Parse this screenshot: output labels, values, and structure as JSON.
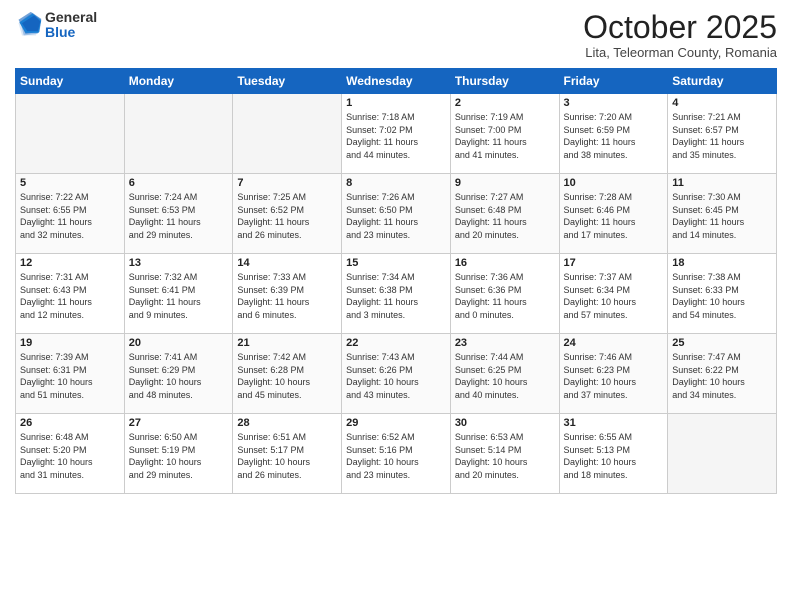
{
  "logo": {
    "general": "General",
    "blue": "Blue"
  },
  "header": {
    "month": "October 2025",
    "location": "Lita, Teleorman County, Romania"
  },
  "weekdays": [
    "Sunday",
    "Monday",
    "Tuesday",
    "Wednesday",
    "Thursday",
    "Friday",
    "Saturday"
  ],
  "weeks": [
    [
      {
        "day": "",
        "info": ""
      },
      {
        "day": "",
        "info": ""
      },
      {
        "day": "",
        "info": ""
      },
      {
        "day": "1",
        "info": "Sunrise: 7:18 AM\nSunset: 7:02 PM\nDaylight: 11 hours\nand 44 minutes."
      },
      {
        "day": "2",
        "info": "Sunrise: 7:19 AM\nSunset: 7:00 PM\nDaylight: 11 hours\nand 41 minutes."
      },
      {
        "day": "3",
        "info": "Sunrise: 7:20 AM\nSunset: 6:59 PM\nDaylight: 11 hours\nand 38 minutes."
      },
      {
        "day": "4",
        "info": "Sunrise: 7:21 AM\nSunset: 6:57 PM\nDaylight: 11 hours\nand 35 minutes."
      }
    ],
    [
      {
        "day": "5",
        "info": "Sunrise: 7:22 AM\nSunset: 6:55 PM\nDaylight: 11 hours\nand 32 minutes."
      },
      {
        "day": "6",
        "info": "Sunrise: 7:24 AM\nSunset: 6:53 PM\nDaylight: 11 hours\nand 29 minutes."
      },
      {
        "day": "7",
        "info": "Sunrise: 7:25 AM\nSunset: 6:52 PM\nDaylight: 11 hours\nand 26 minutes."
      },
      {
        "day": "8",
        "info": "Sunrise: 7:26 AM\nSunset: 6:50 PM\nDaylight: 11 hours\nand 23 minutes."
      },
      {
        "day": "9",
        "info": "Sunrise: 7:27 AM\nSunset: 6:48 PM\nDaylight: 11 hours\nand 20 minutes."
      },
      {
        "day": "10",
        "info": "Sunrise: 7:28 AM\nSunset: 6:46 PM\nDaylight: 11 hours\nand 17 minutes."
      },
      {
        "day": "11",
        "info": "Sunrise: 7:30 AM\nSunset: 6:45 PM\nDaylight: 11 hours\nand 14 minutes."
      }
    ],
    [
      {
        "day": "12",
        "info": "Sunrise: 7:31 AM\nSunset: 6:43 PM\nDaylight: 11 hours\nand 12 minutes."
      },
      {
        "day": "13",
        "info": "Sunrise: 7:32 AM\nSunset: 6:41 PM\nDaylight: 11 hours\nand 9 minutes."
      },
      {
        "day": "14",
        "info": "Sunrise: 7:33 AM\nSunset: 6:39 PM\nDaylight: 11 hours\nand 6 minutes."
      },
      {
        "day": "15",
        "info": "Sunrise: 7:34 AM\nSunset: 6:38 PM\nDaylight: 11 hours\nand 3 minutes."
      },
      {
        "day": "16",
        "info": "Sunrise: 7:36 AM\nSunset: 6:36 PM\nDaylight: 11 hours\nand 0 minutes."
      },
      {
        "day": "17",
        "info": "Sunrise: 7:37 AM\nSunset: 6:34 PM\nDaylight: 10 hours\nand 57 minutes."
      },
      {
        "day": "18",
        "info": "Sunrise: 7:38 AM\nSunset: 6:33 PM\nDaylight: 10 hours\nand 54 minutes."
      }
    ],
    [
      {
        "day": "19",
        "info": "Sunrise: 7:39 AM\nSunset: 6:31 PM\nDaylight: 10 hours\nand 51 minutes."
      },
      {
        "day": "20",
        "info": "Sunrise: 7:41 AM\nSunset: 6:29 PM\nDaylight: 10 hours\nand 48 minutes."
      },
      {
        "day": "21",
        "info": "Sunrise: 7:42 AM\nSunset: 6:28 PM\nDaylight: 10 hours\nand 45 minutes."
      },
      {
        "day": "22",
        "info": "Sunrise: 7:43 AM\nSunset: 6:26 PM\nDaylight: 10 hours\nand 43 minutes."
      },
      {
        "day": "23",
        "info": "Sunrise: 7:44 AM\nSunset: 6:25 PM\nDaylight: 10 hours\nand 40 minutes."
      },
      {
        "day": "24",
        "info": "Sunrise: 7:46 AM\nSunset: 6:23 PM\nDaylight: 10 hours\nand 37 minutes."
      },
      {
        "day": "25",
        "info": "Sunrise: 7:47 AM\nSunset: 6:22 PM\nDaylight: 10 hours\nand 34 minutes."
      }
    ],
    [
      {
        "day": "26",
        "info": "Sunrise: 6:48 AM\nSunset: 5:20 PM\nDaylight: 10 hours\nand 31 minutes."
      },
      {
        "day": "27",
        "info": "Sunrise: 6:50 AM\nSunset: 5:19 PM\nDaylight: 10 hours\nand 29 minutes."
      },
      {
        "day": "28",
        "info": "Sunrise: 6:51 AM\nSunset: 5:17 PM\nDaylight: 10 hours\nand 26 minutes."
      },
      {
        "day": "29",
        "info": "Sunrise: 6:52 AM\nSunset: 5:16 PM\nDaylight: 10 hours\nand 23 minutes."
      },
      {
        "day": "30",
        "info": "Sunrise: 6:53 AM\nSunset: 5:14 PM\nDaylight: 10 hours\nand 20 minutes."
      },
      {
        "day": "31",
        "info": "Sunrise: 6:55 AM\nSunset: 5:13 PM\nDaylight: 10 hours\nand 18 minutes."
      },
      {
        "day": "",
        "info": ""
      }
    ]
  ]
}
